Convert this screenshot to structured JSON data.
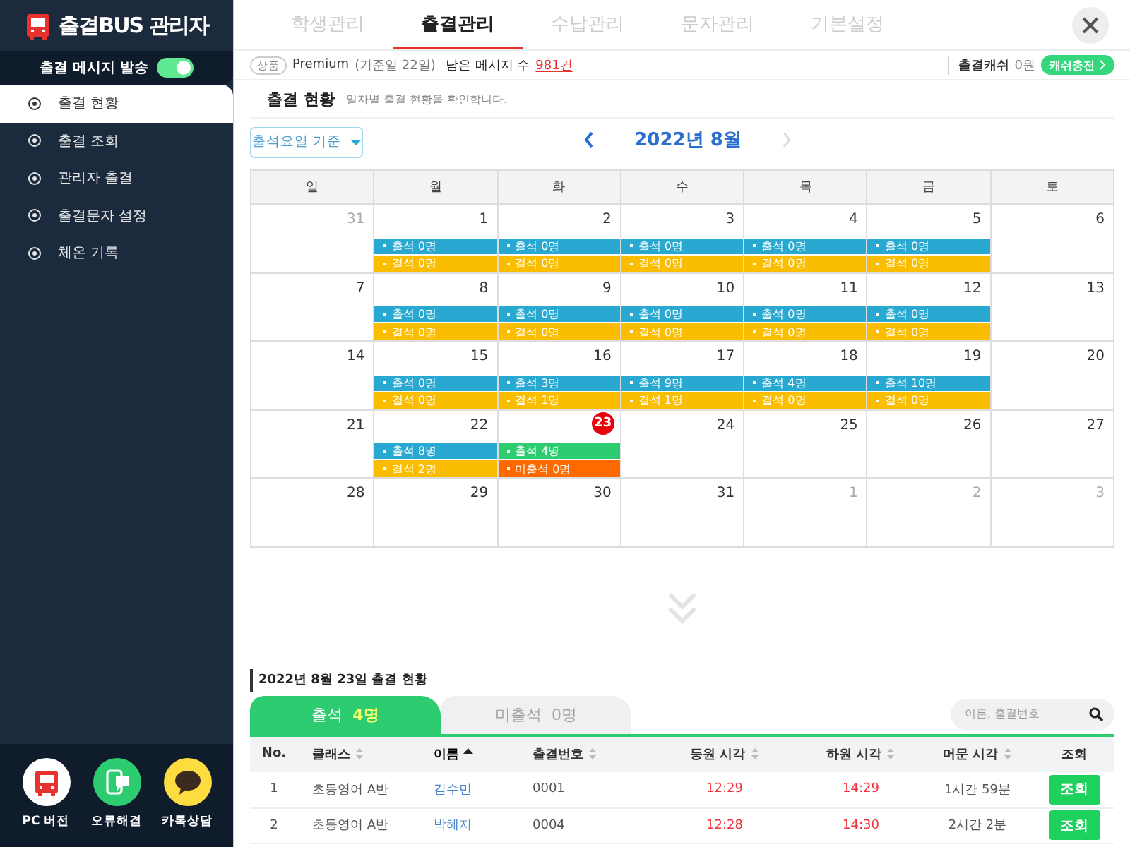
{
  "sidebar": {
    "logo": "출결BUS 관리자",
    "toggle": {
      "label": "출결 메시지 발송",
      "on": true
    },
    "menu": [
      {
        "label": "출결 현황",
        "selected": true
      },
      {
        "label": "출결 조회",
        "selected": false
      },
      {
        "label": "관리자 출결",
        "selected": false
      },
      {
        "label": "출결문자 설정",
        "selected": false
      },
      {
        "label": "체온 기록",
        "selected": false
      }
    ],
    "shortcuts": [
      {
        "kind": "bus",
        "label": "PC 버전"
      },
      {
        "kind": "phone",
        "label": "오류해결"
      },
      {
        "kind": "chat",
        "label": "카톡상담"
      }
    ]
  },
  "top_tabs": [
    {
      "label": "학생관리",
      "selected": false
    },
    {
      "label": "출결관리",
      "selected": true
    },
    {
      "label": "수납관리",
      "selected": false
    },
    {
      "label": "문자관리",
      "selected": false
    },
    {
      "label": "기본설정",
      "selected": false
    }
  ],
  "info_bar": {
    "badge": "상품",
    "plan": "Premium",
    "plan_note": "(기준일 22일)",
    "remaining_label": "남은 메시지 수",
    "remaining": "981건",
    "cash_label": "출결캐쉬",
    "cash": "0원",
    "charge_button": "캐쉬충전"
  },
  "section": {
    "title": "출결 현황",
    "subtitle": "일자별 출결 현황을 확인합니다."
  },
  "calendar": {
    "filter": "출석요일 기준",
    "month": "2022년 8월",
    "next_disabled": true,
    "weekdays": [
      "일",
      "월",
      "화",
      "수",
      "목",
      "금",
      "토"
    ],
    "weeks": [
      [
        {
          "day": "31",
          "muted": true
        },
        {
          "day": "1",
          "events": [
            {
              "kind": "attend",
              "text": "출석 0명"
            },
            {
              "kind": "absent",
              "text": "결석 0명"
            }
          ]
        },
        {
          "day": "2",
          "events": [
            {
              "kind": "attend",
              "text": "출석 0명"
            },
            {
              "kind": "absent",
              "text": "결석 0명"
            }
          ]
        },
        {
          "day": "3",
          "events": [
            {
              "kind": "attend",
              "text": "출석 0명"
            },
            {
              "kind": "absent",
              "text": "결석 0명"
            }
          ]
        },
        {
          "day": "4",
          "events": [
            {
              "kind": "attend",
              "text": "출석 0명"
            },
            {
              "kind": "absent",
              "text": "결석 0명"
            }
          ]
        },
        {
          "day": "5",
          "events": [
            {
              "kind": "attend",
              "text": "출석 0명"
            },
            {
              "kind": "absent",
              "text": "결석 0명"
            }
          ]
        },
        {
          "day": "6"
        }
      ],
      [
        {
          "day": "7"
        },
        {
          "day": "8",
          "events": [
            {
              "kind": "attend",
              "text": "출석 0명"
            },
            {
              "kind": "absent",
              "text": "결석 0명"
            }
          ]
        },
        {
          "day": "9",
          "events": [
            {
              "kind": "attend",
              "text": "출석 0명"
            },
            {
              "kind": "absent",
              "text": "결석 0명"
            }
          ]
        },
        {
          "day": "10",
          "events": [
            {
              "kind": "attend",
              "text": "출석 0명"
            },
            {
              "kind": "absent",
              "text": "결석 0명"
            }
          ]
        },
        {
          "day": "11",
          "events": [
            {
              "kind": "attend",
              "text": "출석 0명"
            },
            {
              "kind": "absent",
              "text": "결석 0명"
            }
          ]
        },
        {
          "day": "12",
          "events": [
            {
              "kind": "attend",
              "text": "출석 0명"
            },
            {
              "kind": "absent",
              "text": "결석 0명"
            }
          ]
        },
        {
          "day": "13"
        }
      ],
      [
        {
          "day": "14"
        },
        {
          "day": "15",
          "events": [
            {
              "kind": "attend",
              "text": "출석 0명"
            },
            {
              "kind": "absent",
              "text": "결석 0명"
            }
          ]
        },
        {
          "day": "16",
          "events": [
            {
              "kind": "attend",
              "text": "출석 3명"
            },
            {
              "kind": "absent",
              "text": "결석 1명"
            }
          ]
        },
        {
          "day": "17",
          "events": [
            {
              "kind": "attend",
              "text": "출석 9명"
            },
            {
              "kind": "absent",
              "text": "결석 1명"
            }
          ]
        },
        {
          "day": "18",
          "events": [
            {
              "kind": "attend",
              "text": "출석 4명"
            },
            {
              "kind": "absent",
              "text": "결석 0명"
            }
          ]
        },
        {
          "day": "19",
          "events": [
            {
              "kind": "attend",
              "text": "출석 10명"
            },
            {
              "kind": "absent",
              "text": "결석 0명"
            }
          ]
        },
        {
          "day": "20"
        }
      ],
      [
        {
          "day": "21"
        },
        {
          "day": "22",
          "events": [
            {
              "kind": "attend",
              "text": "출석 8명"
            },
            {
              "kind": "absent",
              "text": "결석 2명"
            }
          ]
        },
        {
          "day": "23",
          "today": true,
          "events": [
            {
              "kind": "attend-today",
              "text": "출석 4명"
            },
            {
              "kind": "not-yet",
              "text": "미출석 0명"
            }
          ]
        },
        {
          "day": "24"
        },
        {
          "day": "25"
        },
        {
          "day": "26"
        },
        {
          "day": "27"
        }
      ],
      [
        {
          "day": "28"
        },
        {
          "day": "29"
        },
        {
          "day": "30"
        },
        {
          "day": "31"
        },
        {
          "day": "1",
          "muted": true
        },
        {
          "day": "2",
          "muted": true
        },
        {
          "day": "3",
          "muted": true
        }
      ]
    ]
  },
  "daily": {
    "title": "2022년 8월 23일 출결 현황",
    "tabs": [
      {
        "label": "출석",
        "count": "4명",
        "selected": true
      },
      {
        "label": "미출석",
        "count": "0명",
        "selected": false
      }
    ],
    "search": {
      "placeholder": "이름, 출결번호"
    },
    "columns": [
      {
        "label": "No.",
        "sortable": false,
        "sorted": false
      },
      {
        "label": "클래스",
        "sortable": true,
        "sorted": false
      },
      {
        "label": "이름",
        "sortable": true,
        "sorted": true
      },
      {
        "label": "출결번호",
        "sortable": true,
        "sorted": false
      },
      {
        "label": "등원 시각",
        "sortable": true,
        "sorted": false
      },
      {
        "label": "하원 시각",
        "sortable": true,
        "sorted": false
      },
      {
        "label": "머문 시각",
        "sortable": true,
        "sorted": false
      },
      {
        "label": "조회",
        "sortable": false,
        "sorted": false
      }
    ],
    "rows": [
      {
        "no": "1",
        "class": "초등영어 A반",
        "name": "김수민",
        "code": "0001",
        "arrive": "12:29",
        "leave": "14:29",
        "stay": "1시간 59분",
        "button": "조회"
      },
      {
        "no": "2",
        "class": "초등영어 A반",
        "name": "박혜지",
        "code": "0004",
        "arrive": "12:28",
        "leave": "14:30",
        "stay": "2시간 2분",
        "button": "조회"
      }
    ]
  }
}
